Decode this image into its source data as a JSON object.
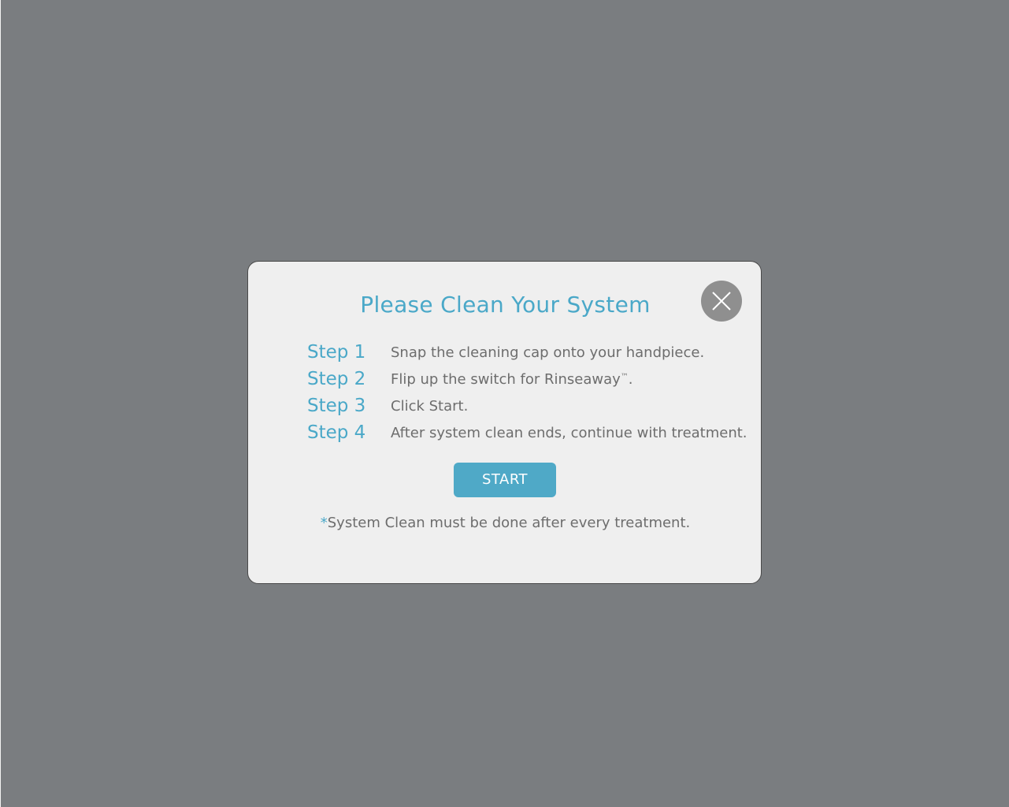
{
  "dialog": {
    "title": "Please Clean Your System",
    "close_icon": "close-icon",
    "steps": [
      {
        "label": "Step 1",
        "text": "Snap the cleaning cap onto your handpiece.",
        "suffix": ""
      },
      {
        "label": "Step 2",
        "text": "Flip up the switch for Rinseaway",
        "trademark": "™",
        "suffix": "."
      },
      {
        "label": "Step 3",
        "text": "Click Start.",
        "suffix": ""
      },
      {
        "label": "Step 4",
        "text": "After system clean ends, continue with treatment.",
        "suffix": ""
      }
    ],
    "start_label": "START",
    "note": {
      "asterisk": "*",
      "text": "System Clean must be done after every treatment."
    }
  },
  "colors": {
    "backdrop": "#7a7d80",
    "dialog_background": "#efefef",
    "accent": "#4aa8c8",
    "button": "#4fa9c7",
    "body_text": "#6d6d6d",
    "close_button": "#8f8f8f"
  }
}
